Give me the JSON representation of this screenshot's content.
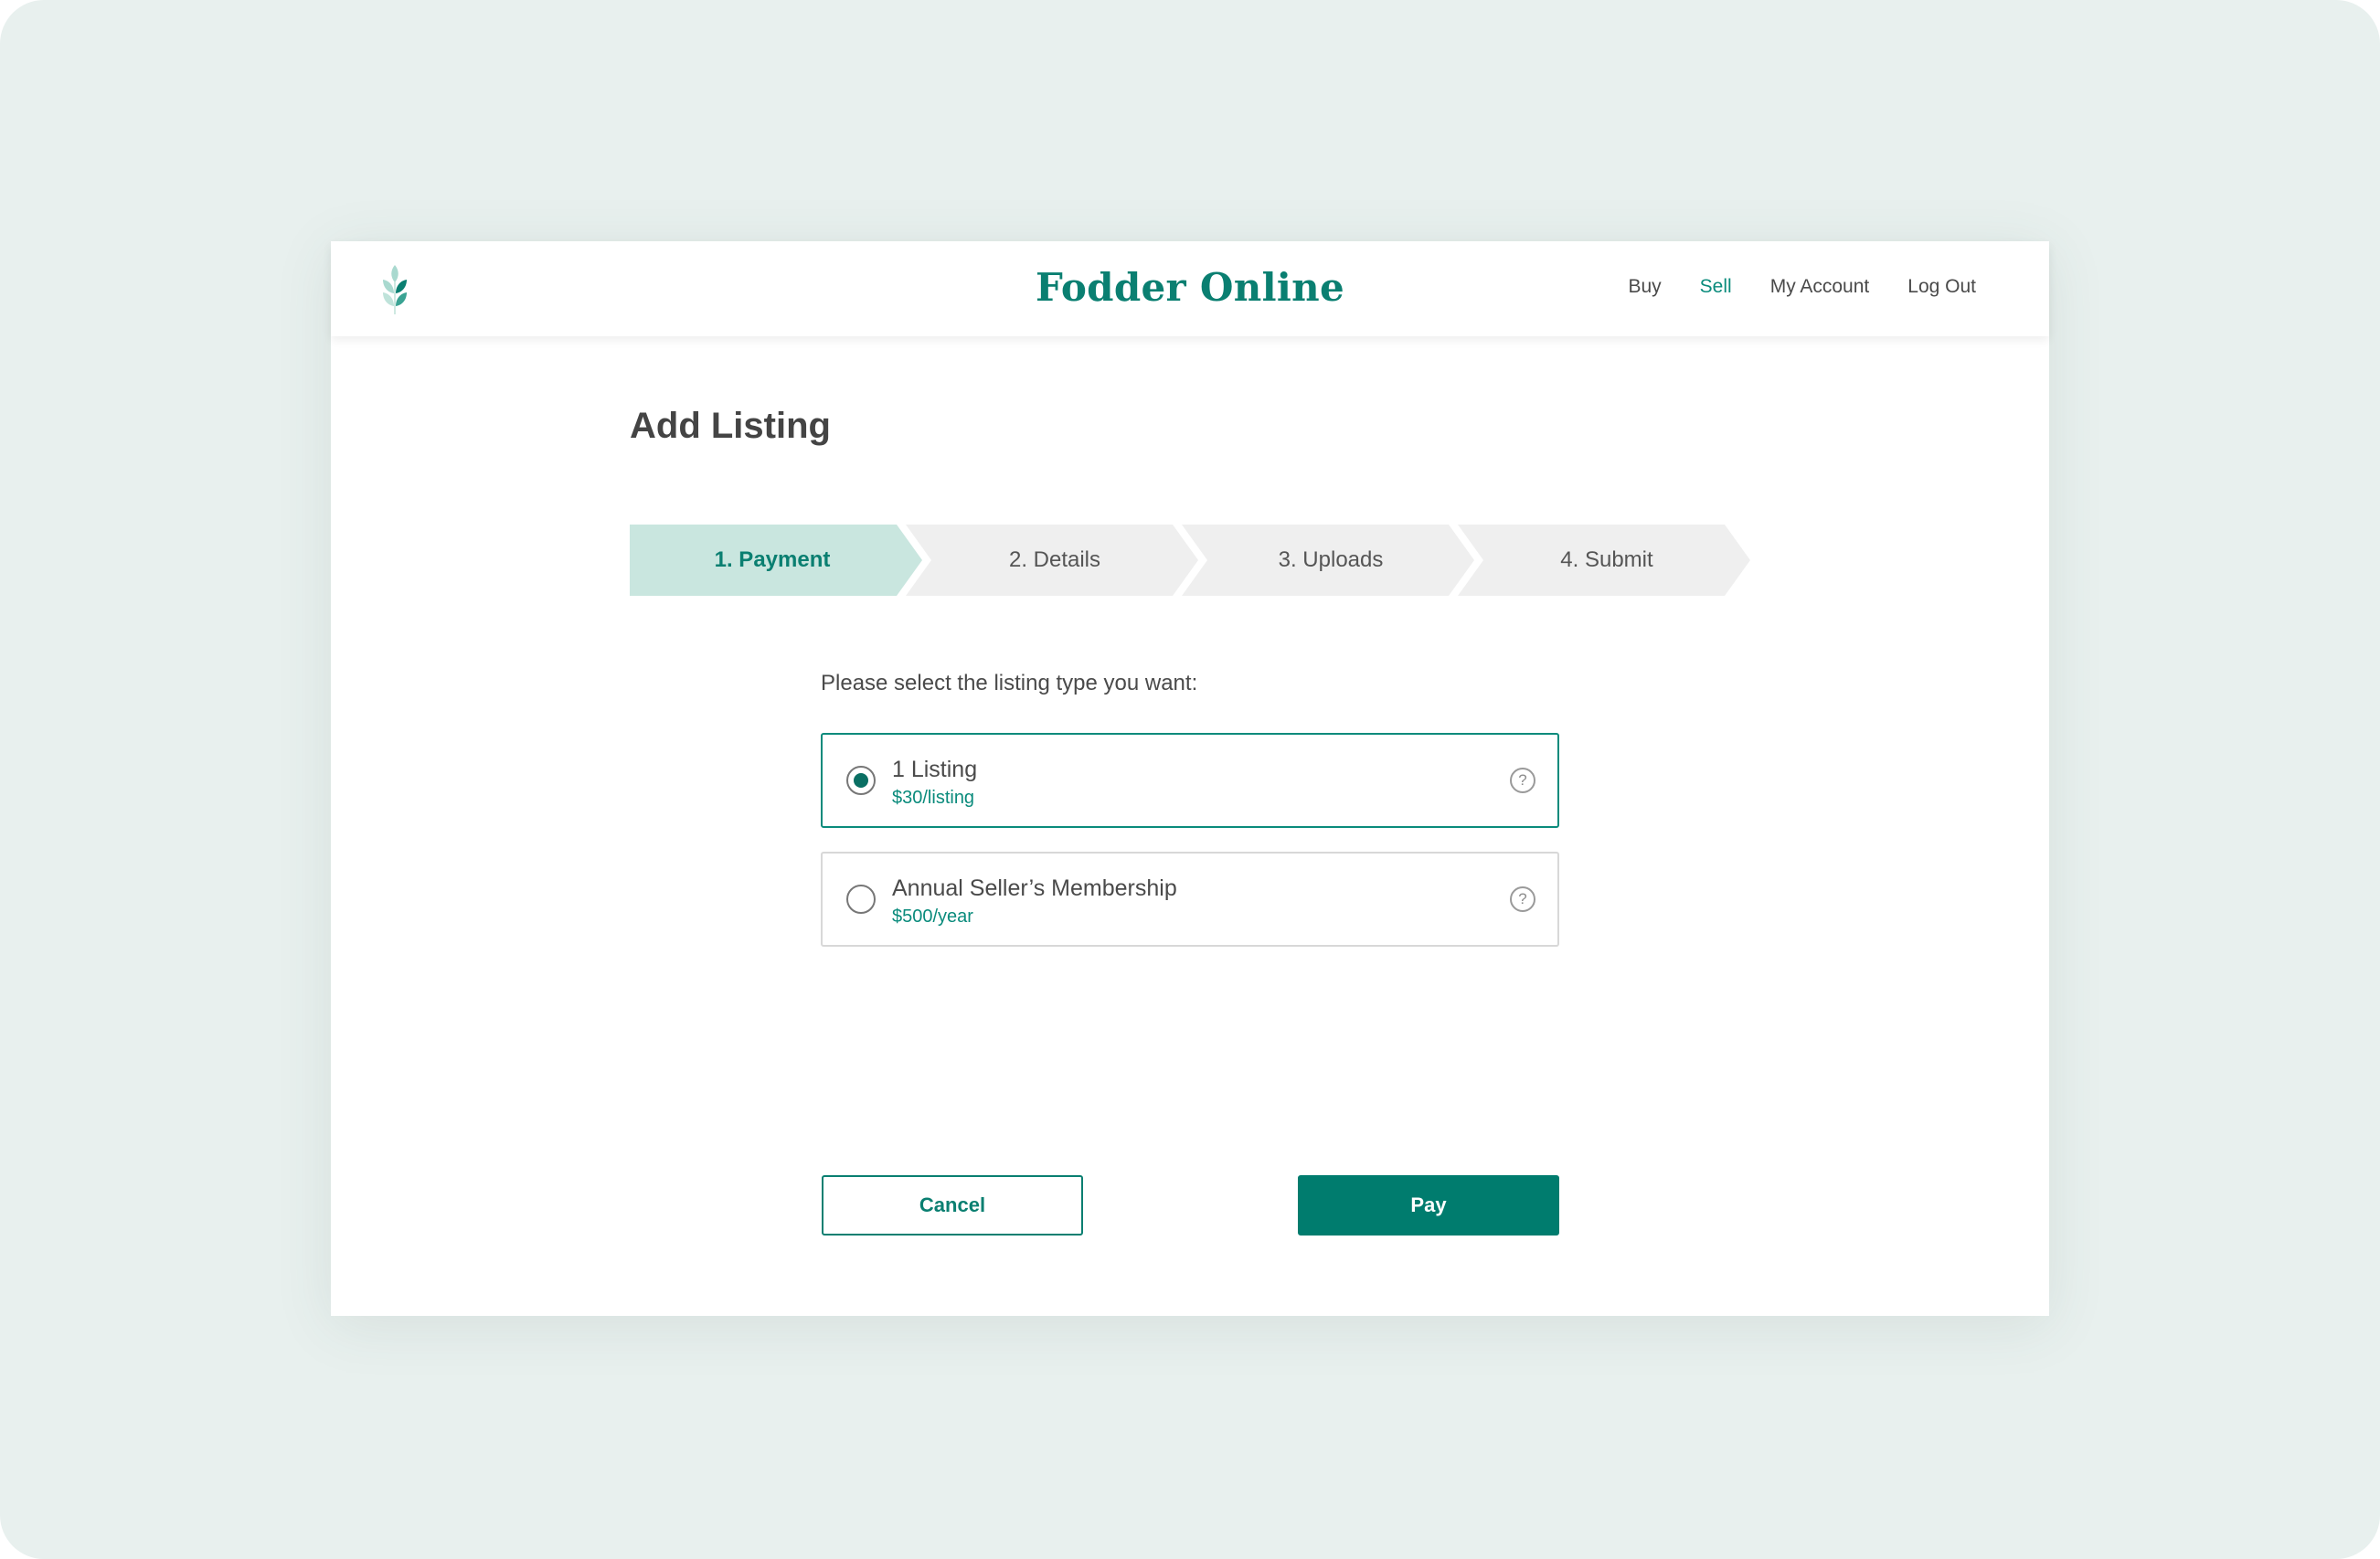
{
  "header": {
    "brand": "Fodder Online",
    "logo_icon": "wheat-icon",
    "nav": [
      {
        "label": "Buy",
        "active": false
      },
      {
        "label": "Sell",
        "active": true
      },
      {
        "label": "My Account",
        "active": false
      },
      {
        "label": "Log Out",
        "active": false
      }
    ]
  },
  "page": {
    "title": "Add Listing",
    "prompt": "Please select the listing type you want:"
  },
  "steps": [
    {
      "label": "1. Payment",
      "active": true
    },
    {
      "label": "2. Details",
      "active": false
    },
    {
      "label": "3. Uploads",
      "active": false
    },
    {
      "label": "4. Submit",
      "active": false
    }
  ],
  "options": [
    {
      "name": "1 Listing",
      "price": "$30/listing",
      "selected": true,
      "help_icon": "question-circle-icon",
      "help_glyph": "?"
    },
    {
      "name": "Annual Seller’s Membership",
      "price": "$500/year",
      "selected": false,
      "help_icon": "question-circle-icon",
      "help_glyph": "?"
    }
  ],
  "actions": {
    "cancel_label": "Cancel",
    "pay_label": "Pay"
  },
  "colors": {
    "brand_green": "#0a7f71",
    "accent_teal": "#0a8b7c",
    "active_step_bg": "#c9e6df",
    "inactive_step_bg": "#efefef",
    "pay_button_bg": "#007c6e",
    "backdrop": "#e8f0ee"
  }
}
